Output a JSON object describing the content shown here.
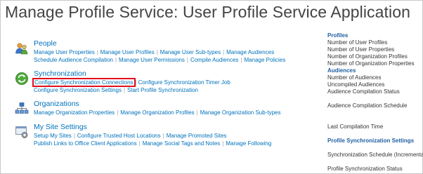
{
  "page": {
    "title": "Manage Profile Service: User Profile Service Application"
  },
  "sections": [
    {
      "title": "People",
      "icon": "people-icon",
      "rows": [
        [
          "Manage User Properties",
          "Manage User Profiles",
          "Manage User Sub-types",
          "Manage Audiences"
        ],
        [
          "Schedule Audience Compilation",
          "Manage User Permissions",
          "Compile Audiences",
          "Manage Policies"
        ]
      ]
    },
    {
      "title": "Synchronization",
      "icon": "synchronization-icon",
      "rows": [
        [
          "Configure Synchronization Connections",
          "Configure Synchronization Timer Job"
        ],
        [
          "Configure Synchronization Settings",
          "Start Profile Synchronization"
        ]
      ],
      "highlighted": "Configure Synchronization Connections"
    },
    {
      "title": "Organizations",
      "icon": "organizations-icon",
      "rows": [
        [
          "Manage Organization Properties",
          "Manage Organization Profiles",
          "Manage Organization Sub-types"
        ]
      ]
    },
    {
      "title": "My Site Settings",
      "icon": "my-site-settings-icon",
      "rows": [
        [
          "Setup My Sites",
          "Configure Trusted Host Locations",
          "Manage Promoted Sites"
        ],
        [
          "Publish Links to Office Client Applications",
          "Manage Social Tags and Notes",
          "Manage Following"
        ]
      ]
    }
  ],
  "status": {
    "profiles": {
      "heading": "Profiles",
      "items": [
        "Number of User Profiles",
        "Number of User Properties",
        "Number of Organization Profiles",
        "Number of Organization Properties"
      ]
    },
    "audiences": {
      "heading": "Audiences",
      "items": [
        "Number of Audiences",
        "Uncompiled Audiences",
        "Audience Compilation Status",
        "",
        "Audience Compilation Schedule",
        "",
        "",
        "Last Compilation Time"
      ]
    },
    "sync": {
      "heading": "Profile Synchronization Settings",
      "items": [
        "",
        "Synchronization Schedule (Incremental)",
        "",
        "Profile Synchronization Status"
      ]
    }
  },
  "colors": {
    "link": "#0072bc",
    "highlight": "#e01020",
    "title": "#444444"
  }
}
